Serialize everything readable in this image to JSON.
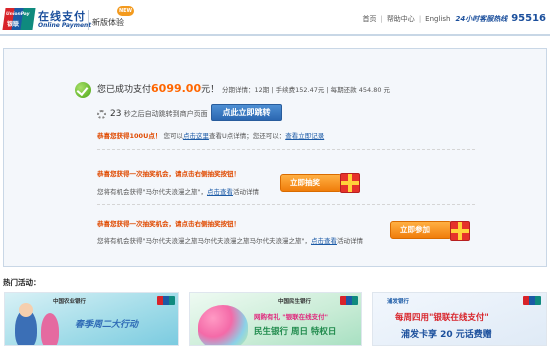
{
  "header": {
    "logo_text_en": "UnionPay",
    "logo_text_cn": "银联",
    "brand_cn": "在线支付",
    "brand_en": "Online Payment",
    "new_label": "新版体验",
    "new_badge": "NEW",
    "links": [
      "首页",
      "帮助中心",
      "English"
    ],
    "hotline_label": "24小时客服热线",
    "hotline_number": "95516"
  },
  "result": {
    "prefix": "您已成功支付",
    "amount": "6099.00",
    "suffix": "元！",
    "meta": "分期详情：12期 | 手续费152.47元 | 每期还款 454.80 元",
    "countdown_seconds": "23",
    "countdown_text": "秒之后自动跳转到商户页面",
    "jump_button": "点此立即跳转",
    "coupon_strong": "恭喜您获得100U点！",
    "coupon_text_1": "您可以",
    "coupon_link_1": "点击这里",
    "coupon_text_2": "查看U点详情；您还可以：",
    "coupon_link_2": "查看立即记录"
  },
  "lottery1": {
    "title": "恭喜您获得一次抽奖机会，请点击右侧抽奖按钮！",
    "desc_text": "您将有机会获得\"马尔代夫浪漫之旅\"，",
    "desc_link": "点击查看",
    "desc_tail": "活动详情",
    "button": "立即抽奖"
  },
  "lottery2": {
    "title": "恭喜您获得一次抽奖机会，请点击右侧抽奖按钮！",
    "desc_text": "您将有机会获得\"马尔代夫浪漫之旅马尔代夫浪漫之旅马尔代夫浪漫之旅\"，",
    "desc_link": "点击查看",
    "desc_tail": "活动详情",
    "button": "立即参加"
  },
  "hot": {
    "title": "热门活动："
  },
  "banners": [
    {
      "bank": "中国农业银行",
      "line1": "春季周二大行动",
      "line2": "",
      "line3": ""
    },
    {
      "bank": "中国民生银行",
      "line1": "网购有礼 \"银联在线支付\"",
      "line2": "民生银行 周日 特权日",
      "line3": ""
    },
    {
      "bank": "浦发银行",
      "line1": "每周四用\"银联在线支付\"",
      "line2": "浦发卡享 20 元话费赠",
      "line3": ""
    }
  ],
  "colors": {
    "accent_blue": "#1b4f9c",
    "amount_orange": "#ff6600",
    "button_orange": "#f07d0b"
  }
}
